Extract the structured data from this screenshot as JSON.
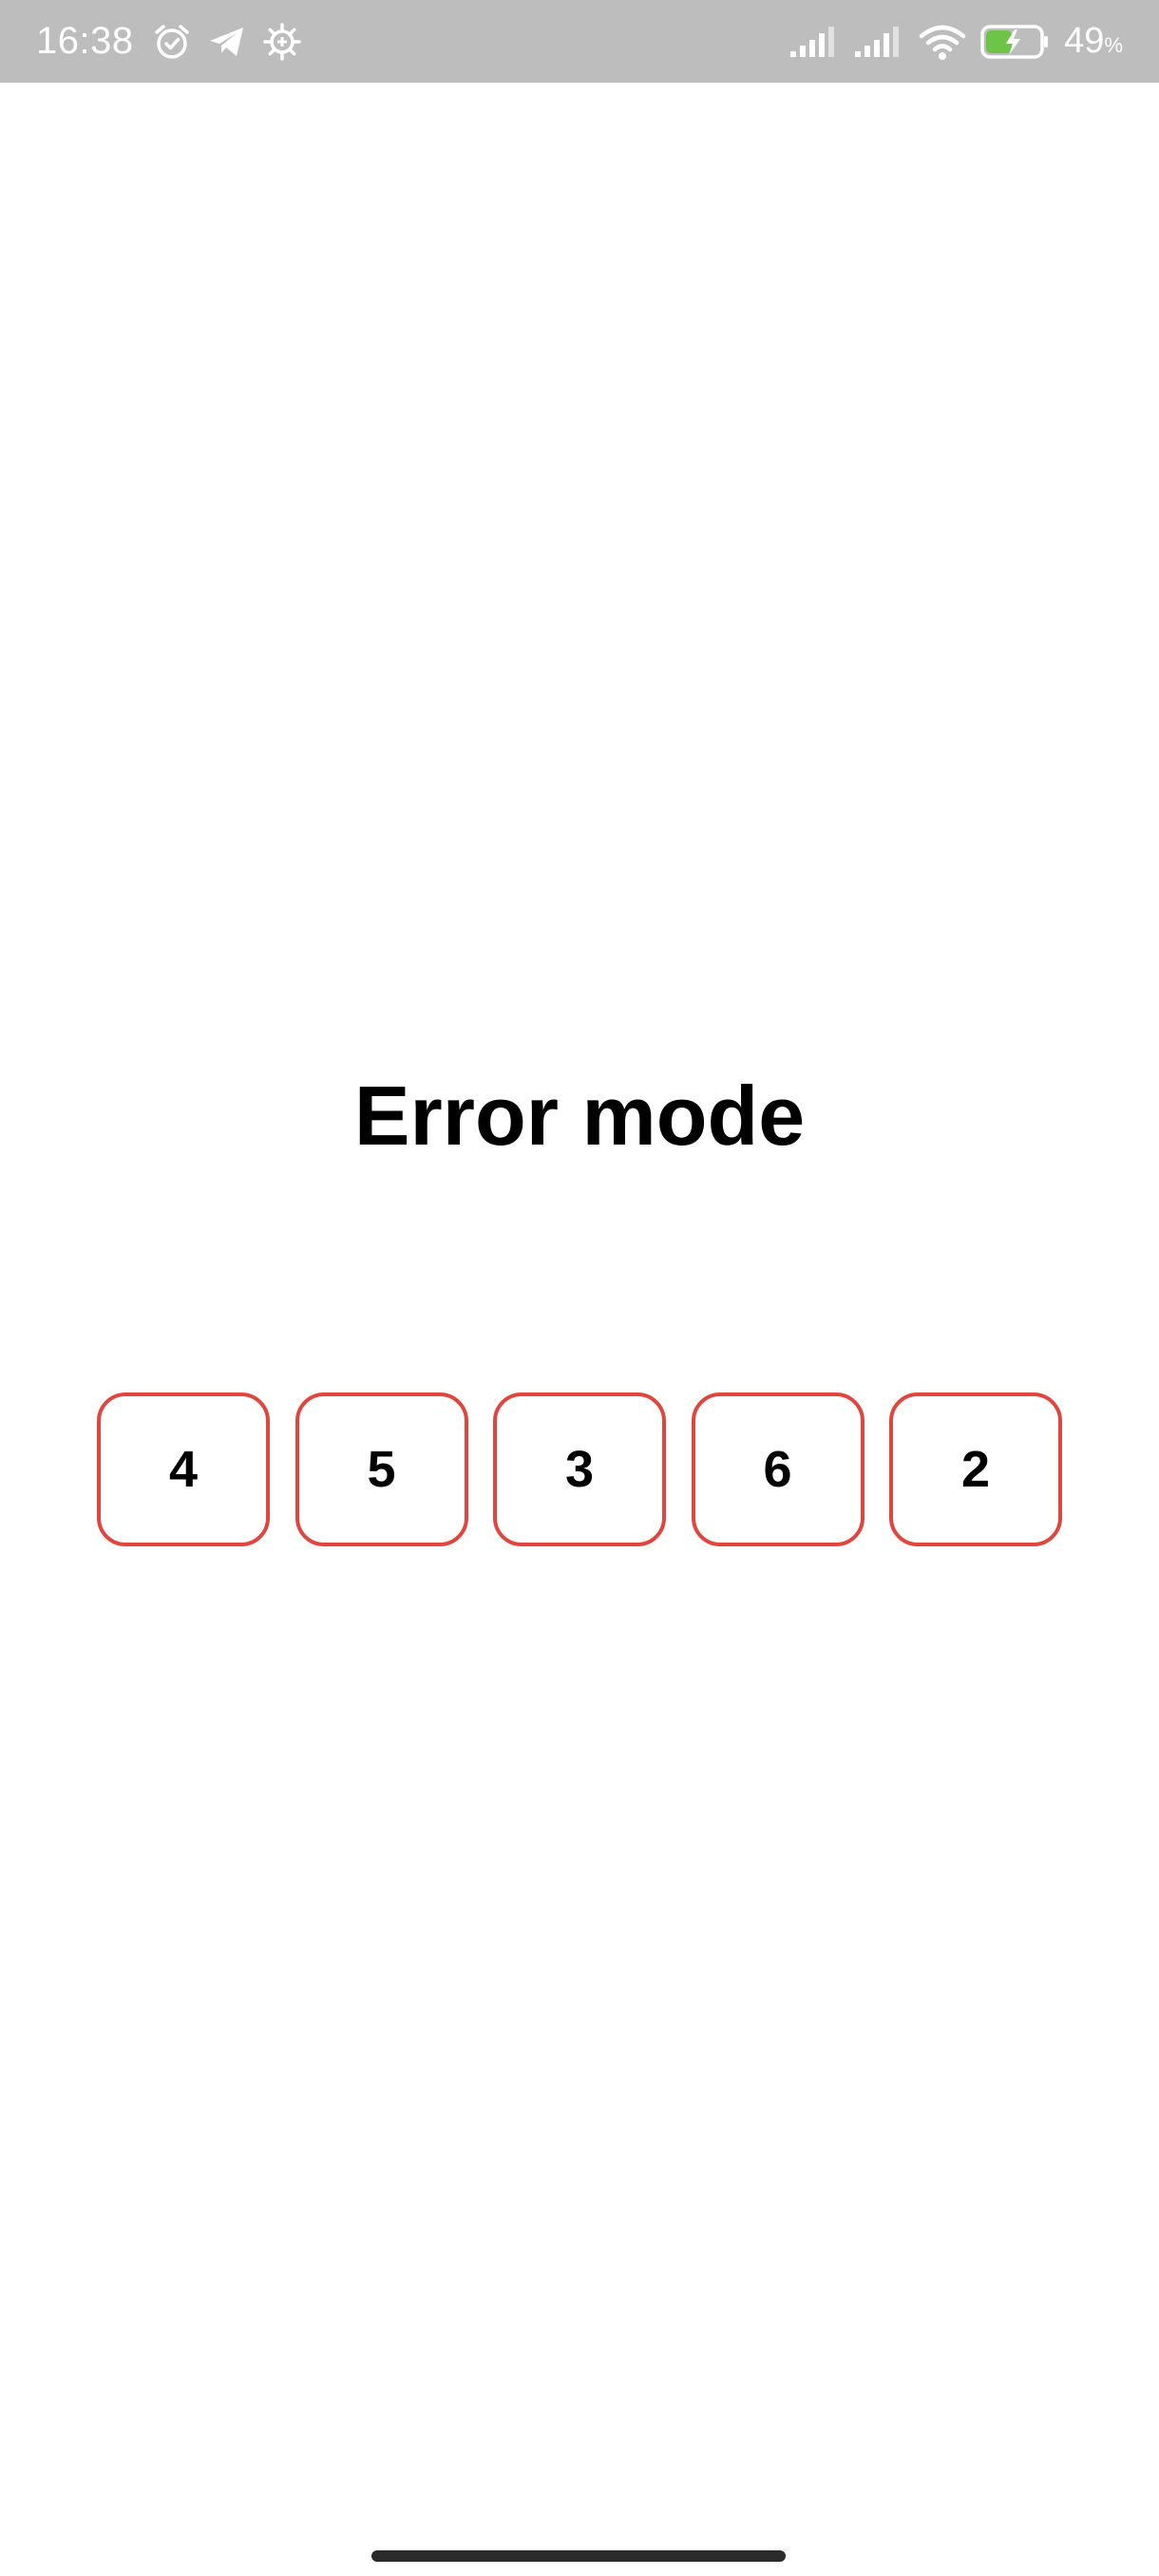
{
  "status_bar": {
    "time": "16:38",
    "battery_percent": "49",
    "battery_unit": "%",
    "battery_level": 0.49,
    "charging": true,
    "left_icons": [
      "alarm-icon",
      "telegram-icon",
      "settings-gear-icon"
    ],
    "right_icons": [
      "signal-icon",
      "signal-icon",
      "wifi-icon",
      "battery-charging-icon"
    ],
    "background_color": "#bdbdbd",
    "battery_fill_color": "#6ec446"
  },
  "screen": {
    "title": "Error mode",
    "code_digits": [
      "4",
      "5",
      "3",
      "6",
      "2"
    ],
    "error_border_color": "#e0463e"
  }
}
